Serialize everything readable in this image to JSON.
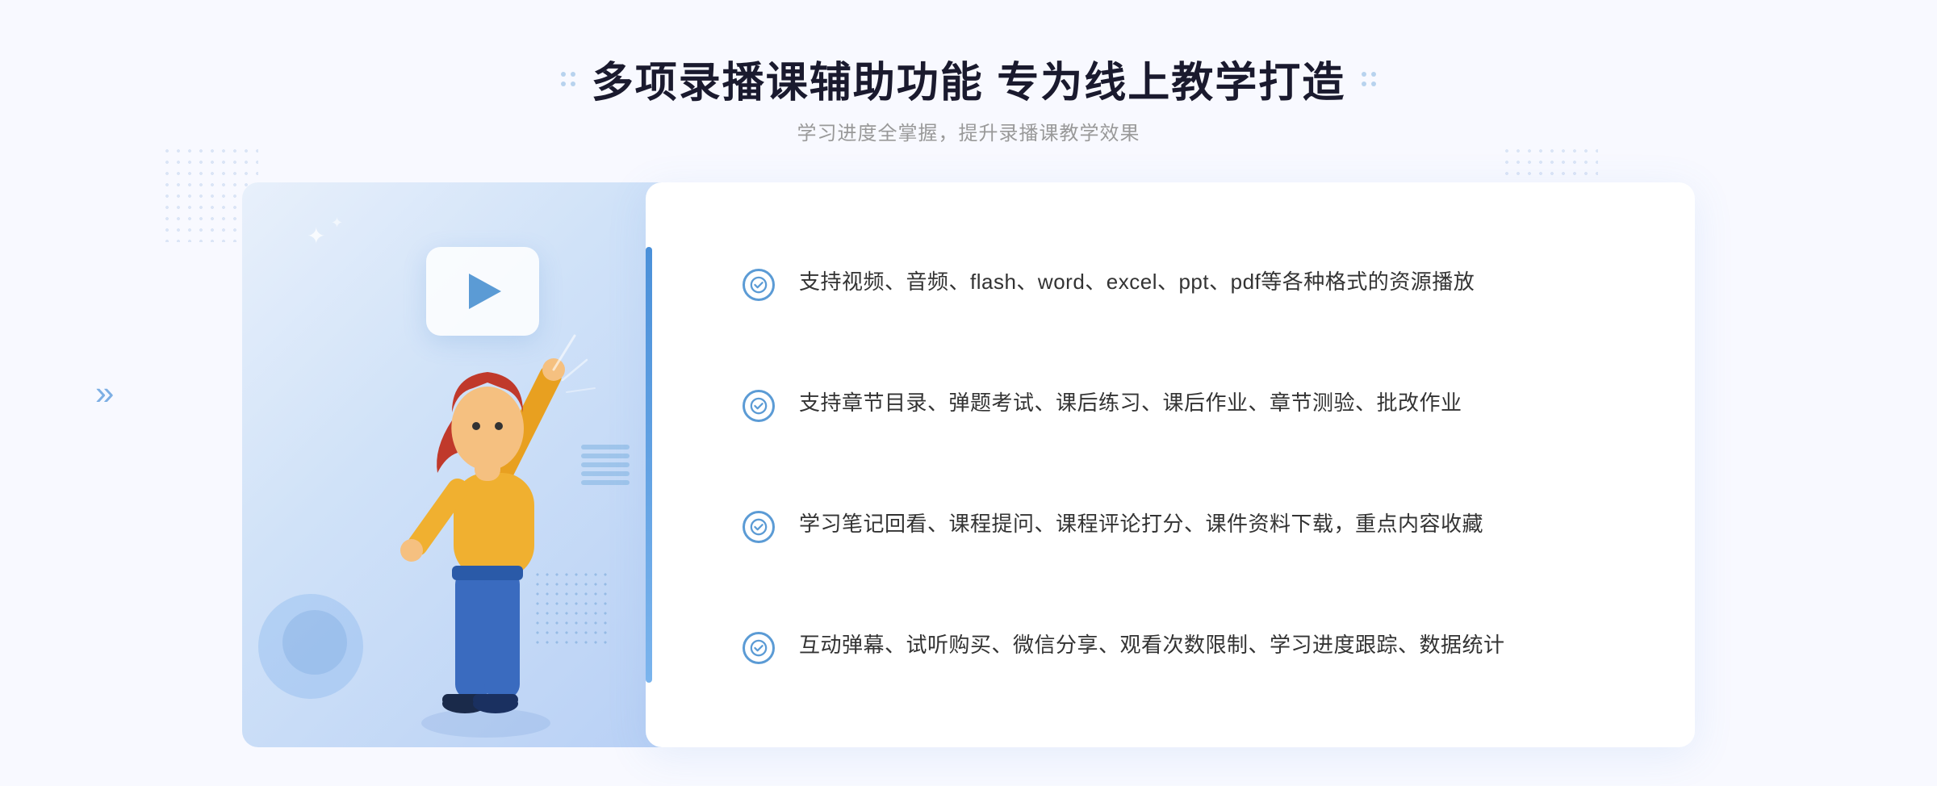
{
  "header": {
    "title": "多项录播课辅助功能 专为线上教学打造",
    "subtitle": "学习进度全掌握，提升录播课教学效果",
    "title_part1": "多项录播课辅助功能",
    "title_part2": "专为线上教学打造"
  },
  "features": [
    {
      "id": 1,
      "text": "支持视频、音频、flash、word、excel、ppt、pdf等各种格式的资源播放"
    },
    {
      "id": 2,
      "text": "支持章节目录、弹题考试、课后练习、课后作业、章节测验、批改作业"
    },
    {
      "id": 3,
      "text": "学习笔记回看、课程提问、课程评论打分、课件资料下载，重点内容收藏"
    },
    {
      "id": 4,
      "text": "互动弹幕、试听购买、微信分享、观看次数限制、学习进度跟踪、数据统计"
    }
  ],
  "colors": {
    "primary": "#4a90d9",
    "primary_light": "#7ab4ed",
    "bg_gradient_start": "#e8f0fb",
    "bg_gradient_end": "#b8d0f5",
    "text_dark": "#1a1a2e",
    "text_gray": "#999999",
    "text_feature": "#333333",
    "check_border": "#5b9bd5"
  },
  "icons": {
    "chevron_left": "»",
    "check": "✓"
  }
}
